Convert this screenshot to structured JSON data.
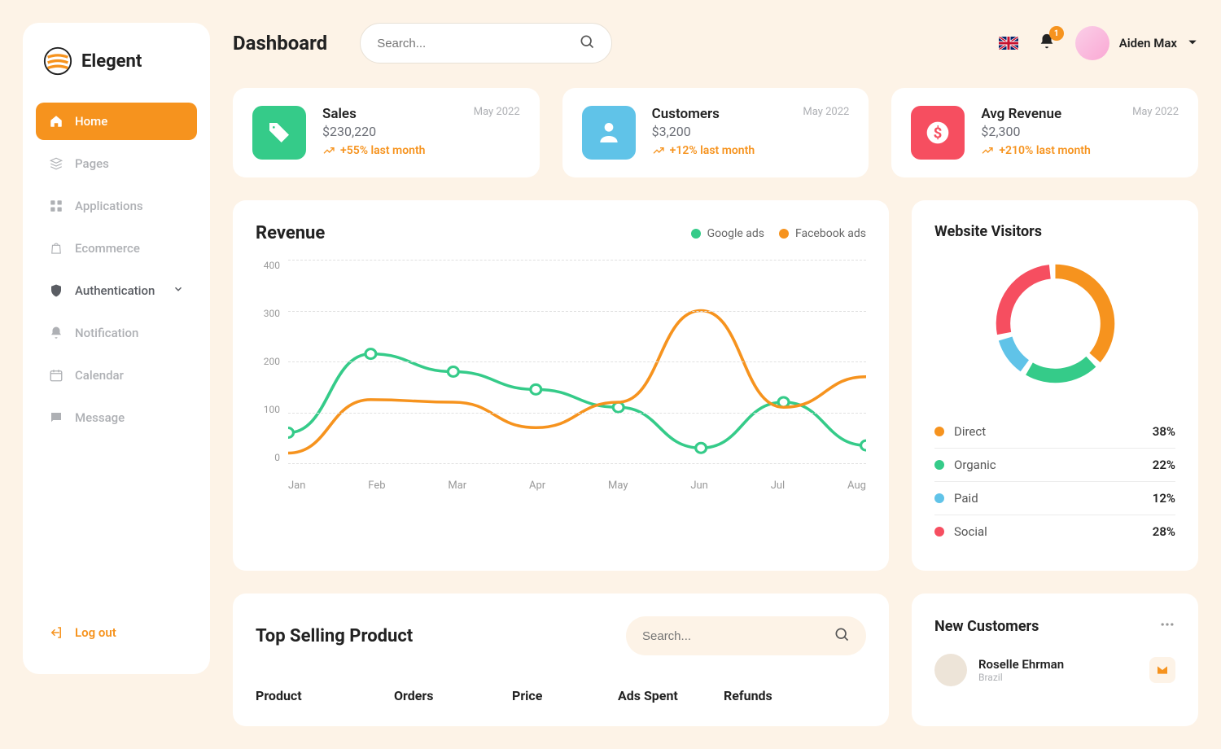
{
  "brand": "Elegent",
  "header": {
    "title": "Dashboard",
    "search_placeholder": "Search...",
    "notification_count": "1",
    "user_name": "Aiden Max"
  },
  "sidebar": {
    "items": [
      {
        "label": "Home"
      },
      {
        "label": "Pages"
      },
      {
        "label": "Applications"
      },
      {
        "label": "Ecommerce"
      },
      {
        "label": "Authentication"
      },
      {
        "label": "Notification"
      },
      {
        "label": "Calendar"
      },
      {
        "label": "Message"
      }
    ],
    "logout": "Log out"
  },
  "stats": [
    {
      "title": "Sales",
      "date": "May 2022",
      "value": "$230,220",
      "trend": "+55% last month"
    },
    {
      "title": "Customers",
      "date": "May 2022",
      "value": "$3,200",
      "trend": "+12% last month"
    },
    {
      "title": "Avg Revenue",
      "date": "May 2022",
      "value": "$2,300",
      "trend": "+210% last month"
    }
  ],
  "revenue": {
    "title": "Revenue",
    "legend": [
      {
        "label": "Google ads",
        "color": "#35CB89"
      },
      {
        "label": "Facebook ads",
        "color": "#F6931E"
      }
    ]
  },
  "visitors": {
    "title": "Website Visitors",
    "items": [
      {
        "label": "Direct",
        "value": "38%",
        "color": "#F6931E"
      },
      {
        "label": "Organic",
        "value": "22%",
        "color": "#35CB89"
      },
      {
        "label": "Paid",
        "value": "12%",
        "color": "#60C3E8"
      },
      {
        "label": "Social",
        "value": "28%",
        "color": "#F64E60"
      }
    ]
  },
  "topselling": {
    "title": "Top Selling Product",
    "search_placeholder": "Search...",
    "columns": [
      "Product",
      "Orders",
      "Price",
      "Ads Spent",
      "Refunds"
    ]
  },
  "newcust": {
    "title": "New Customers",
    "items": [
      {
        "name": "Roselle Ehrman",
        "sub": "Brazil"
      }
    ]
  },
  "chart_data": [
    {
      "type": "line",
      "title": "Revenue",
      "xlabel": "",
      "ylabel": "",
      "ylim": [
        0,
        400
      ],
      "x": [
        "Jan",
        "Feb",
        "Mar",
        "Apr",
        "May",
        "Jun",
        "Jul",
        "Aug"
      ],
      "series": [
        {
          "name": "Google ads",
          "color": "#35CB89",
          "values": [
            60,
            215,
            180,
            145,
            110,
            30,
            120,
            35
          ]
        },
        {
          "name": "Facebook ads",
          "color": "#F6931E",
          "values": [
            20,
            125,
            120,
            70,
            120,
            300,
            110,
            170
          ]
        }
      ]
    },
    {
      "type": "pie",
      "title": "Website Visitors",
      "series": [
        {
          "name": "Direct",
          "value": 38,
          "color": "#F6931E"
        },
        {
          "name": "Organic",
          "value": 22,
          "color": "#35CB89"
        },
        {
          "name": "Paid",
          "value": 12,
          "color": "#60C3E8"
        },
        {
          "name": "Social",
          "value": 28,
          "color": "#F64E60"
        }
      ]
    }
  ]
}
